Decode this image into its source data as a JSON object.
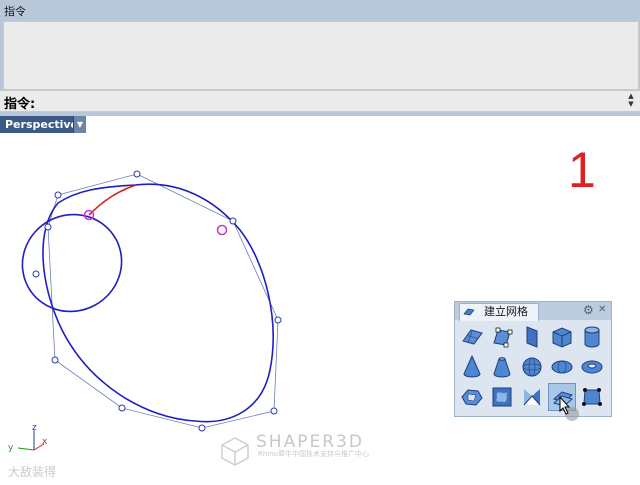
{
  "command_panel": {
    "title": "指令",
    "prompt": "指令:",
    "input_value": ""
  },
  "viewport": {
    "name": "Perspective",
    "step_label": "1",
    "axes": {
      "x": "x",
      "y": "y",
      "z": "z"
    }
  },
  "toolbar": {
    "title": "建立网格",
    "gear_icon": "gear-icon",
    "close_icon": "close-icon",
    "buttons": [
      "mesh-plane-icon",
      "mesh-polygon-icon",
      "mesh-box-face-icon",
      "mesh-box-icon",
      "mesh-cylinder-icon",
      "mesh-cone-icon",
      "mesh-truncated-cone-icon",
      "mesh-sphere-icon",
      "mesh-ellipsoid-icon",
      "mesh-torus-icon",
      "mesh-from-nurbs-icon",
      "mesh-patch-icon",
      "mesh-corner-icon",
      "mesh-from-closed-curves-icon",
      "mesh-from-points-icon"
    ]
  },
  "watermark": {
    "brand": "SHAPER3D",
    "subtitle": "Rhino犀牛中国技术支持与推广中心",
    "corner": "大敌装得"
  },
  "colors": {
    "curve_blue": "#1f1fbf",
    "control_polygon": "#6c7fb8",
    "highlight_curve": "#d42020",
    "selected_point": "#cc33cc",
    "step_number": "#e02020"
  }
}
